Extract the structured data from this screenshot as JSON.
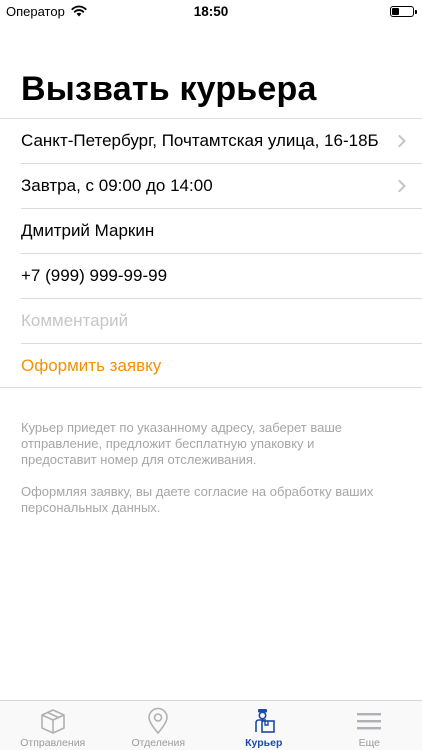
{
  "status_bar": {
    "carrier": "Оператор",
    "time": "18:50",
    "battery_level": 0.35,
    "icons": [
      "wifi-icon",
      "battery-icon"
    ]
  },
  "page": {
    "title": "Вызвать курьера"
  },
  "form": {
    "address": "Санкт-Петербург, Почтамтская улица, 16-18Б",
    "time_slot": "Завтра, с 09:00 до 14:00",
    "name": "Дмитрий Маркин",
    "phone": "+7 (999) 999-99-99",
    "comment_placeholder": "Комментарий",
    "submit_label": "Оформить заявку"
  },
  "notes": {
    "courier_info": "Курьер приедет по указанному адресу, заберет ваше отправление, предложит бесплатную упаковку и предоставит номер для отслеживания.",
    "consent": "Оформляя заявку, вы даете согласие на обработку ваших персональных данных."
  },
  "tabs": [
    {
      "label": "Отправления",
      "icon": "box-icon",
      "active": false
    },
    {
      "label": "Отделения",
      "icon": "location-pin-icon",
      "active": false
    },
    {
      "label": "Курьер",
      "icon": "courier-icon",
      "active": true
    },
    {
      "label": "Еще",
      "icon": "menu-icon",
      "active": false
    }
  ],
  "colors": {
    "accent": "#f39200",
    "tab_active": "#1c4aa5",
    "tab_inactive": "#9a9aa0",
    "secondary_text": "#a6a6ab"
  }
}
